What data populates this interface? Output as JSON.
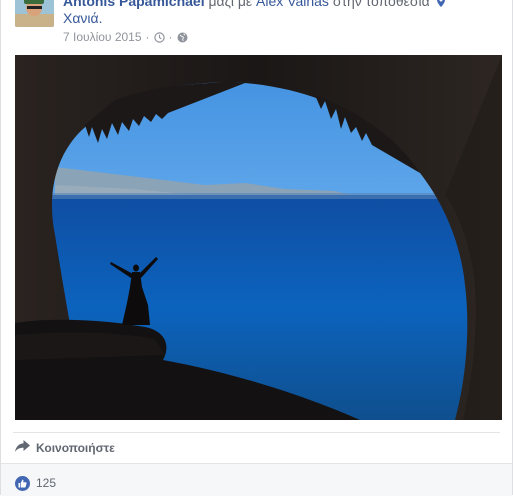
{
  "header": {
    "author": "Antonis Papamichael",
    "with_text": "μαζί με",
    "companion": "Alex Vainas",
    "at_text": "στην τοποθεσία",
    "location": "Χανιά.",
    "date": "7 Ιουλίου 2015",
    "separator": "·"
  },
  "icons": {
    "clock": "clock-icon",
    "privacy": "globe-icon",
    "location": "map-pin-icon",
    "share": "share-arrow-icon",
    "like": "thumbs-up-icon"
  },
  "actions": {
    "share_label": "Κοινοποιήστε"
  },
  "reactions": {
    "like_count": "125"
  },
  "colors": {
    "link": "#365899",
    "muted": "#90949c",
    "like_badge": "#4267b2",
    "footer_bg": "#f6f7f9"
  }
}
